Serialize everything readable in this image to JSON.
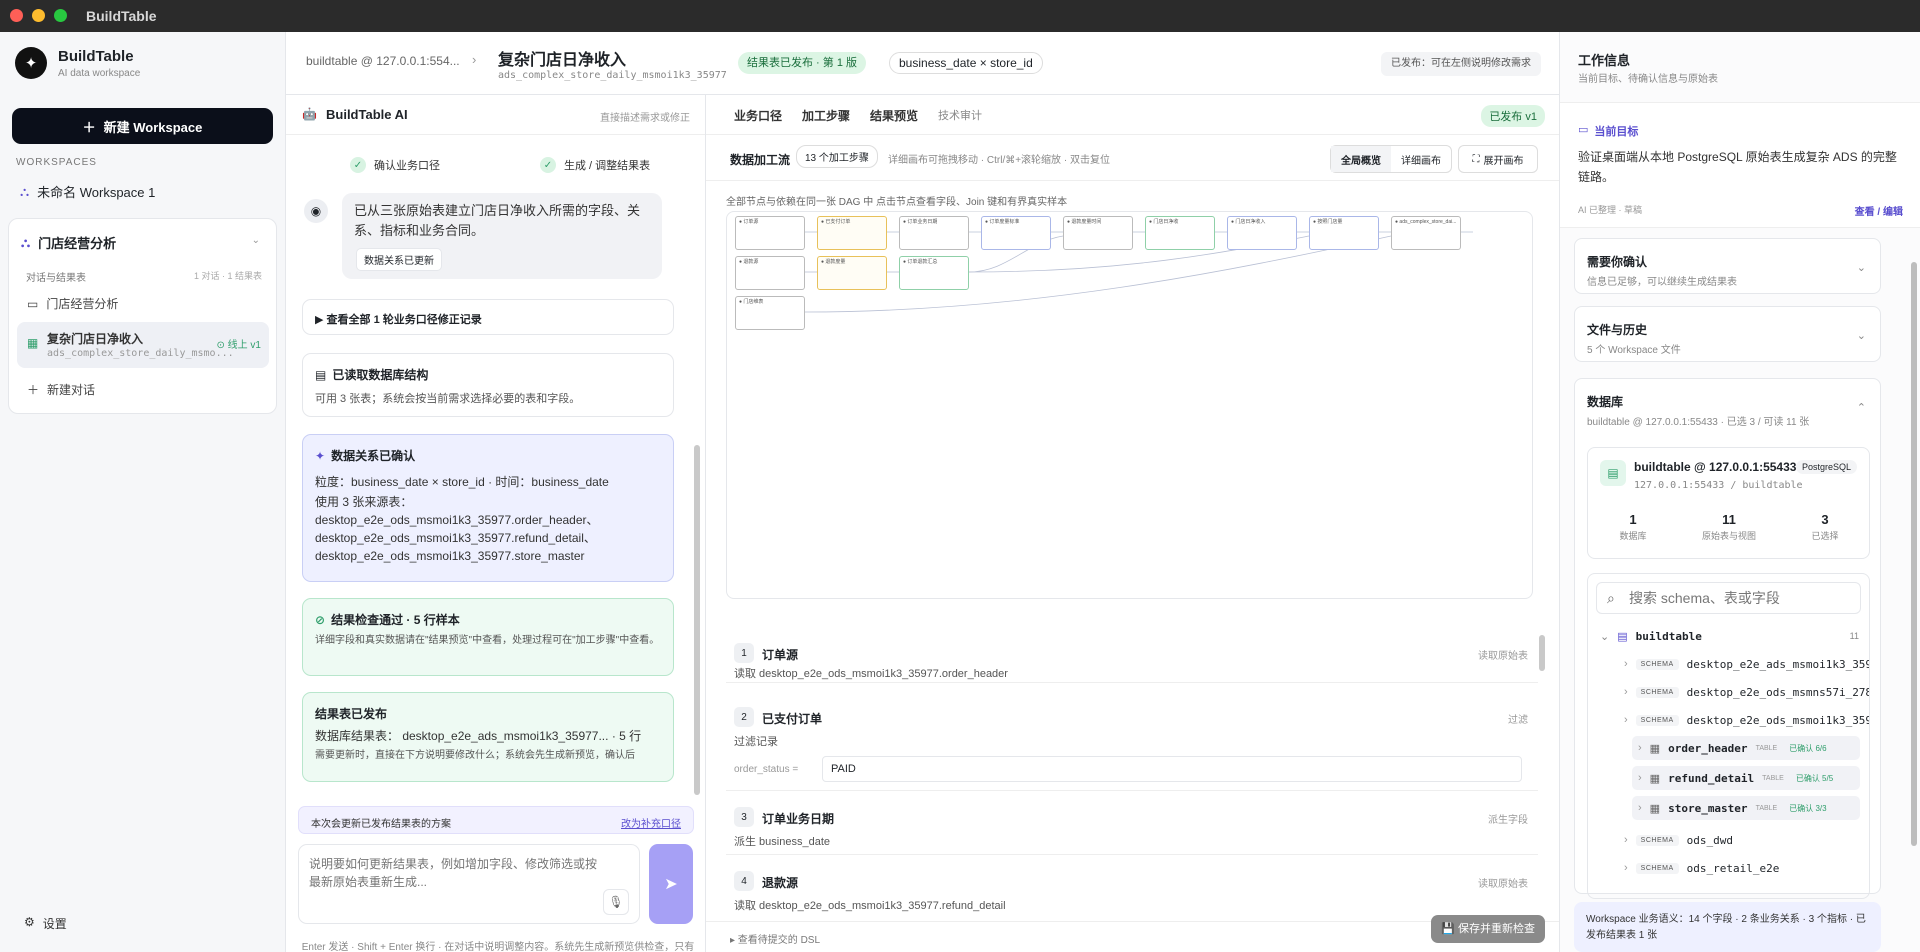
{
  "window": {
    "title": "BuildTable"
  },
  "sidebar": {
    "brand": "BuildTable",
    "brand_sub": "AI data workspace",
    "new_button": "新建 Workspace",
    "ws_header": "WORKSPACES",
    "ws_unnamed": "未命名 Workspace 1",
    "ws_active": "门店经营分析",
    "section": "对话与结果表",
    "section_meta": "1 对话 · 1 结果表",
    "conv": "门店经营分析",
    "result_name": "复杂门店日净收入",
    "result_sub": "ads_complex_store_daily_msmo...",
    "result_badge": "线上 v1",
    "new_conv": "新建对话",
    "settings": "设置"
  },
  "header": {
    "crumb": "buildtable @ 127.0.0.1:554...",
    "title": "复杂门店日净收入",
    "subtitle": "ads_complex_store_daily_msmoi1k3_35977",
    "status": "结果表已发布 · 第 1 版",
    "grain": "business_date × store_id",
    "notice": "已发布：可在左侧说明修改需求"
  },
  "chat": {
    "title": "BuildTable AI",
    "hint": "直接描述需求或修正",
    "step1": "确认业务口径",
    "step2": "生成 / 调整结果表",
    "bubble": "已从三张原始表建立门店日净收入所需的字段、关系、指标和业务合同。",
    "bubble_tag": "数据关系已更新",
    "history": "▶ 查看全部 1 轮业务口径修正记录",
    "c1_title": "已读取数据库结构",
    "c1_body": "可用 3 张表；系统会按当前需求选择必要的表和字段。",
    "c2_title": "数据关系已确认",
    "c2_l1": "粒度：business_date × store_id · 时间：business_date",
    "c2_l2": "使用 3 张来源表：",
    "c2_l3": "desktop_e2e_ods_msmoi1k3_35977.order_header、",
    "c2_l4": "desktop_e2e_ods_msmoi1k3_35977.refund_detail、",
    "c2_l5": "desktop_e2e_ods_msmoi1k3_35977.store_master",
    "c3_title": "结果检查通过 · 5 行样本",
    "c3_body": "详细字段和真实数据请在\"结果预览\"中查看，处理过程可在\"加工步骤\"中查看。",
    "c4_title": "结果表已发布",
    "c4_l1": "数据库结果表： desktop_e2e_ads_msmoi1k3_35977... · 5 行",
    "c4_l2": "需要更新时，直接在下方说明要修改什么；系统会先生成新预览，确认后",
    "notice_a": "本次会更新已发布结果表的方案",
    "notice_b": "改为补充口径",
    "placeholder": "说明要如何更新结果表，例如增加字段、修改筛选或按最新原始表重新生成...",
    "footer": "Enter 发送 · Shift + Enter 换行 · 在对话中说明调整内容。系统先生成新预览供检查，只有再次发布才会更新稳定结果。"
  },
  "main": {
    "tabs": [
      "业务口径",
      "加工步骤",
      "结果预览",
      "技术审计"
    ],
    "published": "已发布 v1",
    "flow_title": "数据加工流",
    "flow_count": "13 个加工步骤",
    "flow_desc": "详细画布可拖拽移动 · Ctrl/⌘+滚轮缩放 · 双击复位",
    "seg_a": "全局概览",
    "seg_b": "详细画布",
    "expand": "展开画布",
    "canvas_hint": "全部节点与依赖在同一张 DAG 中      点击节点查看字段、Join 键和有界真实样本",
    "nodes_row1": [
      "订单源",
      "已支付订单",
      "订单业务日期",
      "订单度量标准",
      "退款度量时间",
      "门店日净收",
      "门店日净收入",
      "按照门店量",
      "ads_complex_store_dai..."
    ],
    "nodes_row2": [
      "退款源",
      "退款度量",
      "订单退款汇总"
    ],
    "nodes_row3": [
      "门店维表"
    ],
    "steps": [
      {
        "no": "1",
        "title": "订单源",
        "tag": "读取原始表",
        "desc": "读取 desktop_e2e_ods_msmoi1k3_35977.order_header"
      },
      {
        "no": "2",
        "title": "已支付订单",
        "tag": "过滤",
        "desc": "过滤记录",
        "field": "order_status =",
        "value": "PAID"
      },
      {
        "no": "3",
        "title": "订单业务日期",
        "tag": "派生字段",
        "desc": "派生 business_date"
      },
      {
        "no": "4",
        "title": "退款源",
        "tag": "读取原始表",
        "desc": "读取 desktop_e2e_ods_msmoi1k3_35977.refund_detail"
      }
    ],
    "dsl": "▸ 查看待提交的 DSL",
    "save": "保存并重新检查"
  },
  "right": {
    "title": "工作信息",
    "sub": "当前目标、待确认信息与原始表",
    "goal_t": "当前目标",
    "goal": "验证桌面端从本地 PostgreSQL 原始表生成复杂 ADS 的完整链路。",
    "goal_s": "AI 已整理 · 草稿",
    "goal_e": "查看 / 编辑",
    "a1_t": "需要你确认",
    "a1_s": "信息已足够，可以继续生成结果表",
    "a2_t": "文件与历史",
    "a2_s": "5 个 Workspace 文件",
    "a3_t": "数据库",
    "a3_s": "buildtable @ 127.0.0.1:55433 · 已选 3 / 可读 11 张",
    "db_name": "buildtable @ 127.0.0.1:55433",
    "db_engine": "PostgreSQL",
    "db_addr": "127.0.0.1:55433 / buildtable",
    "stat1": "1",
    "stat1_l": "数据库",
    "stat2": "11",
    "stat2_l": "原始表与视图",
    "stat3": "3",
    "stat3_l": "已选择",
    "search": "搜索 schema、表或字段",
    "root": "buildtable",
    "root_count": "11",
    "schema_tag": "SCHEMA",
    "table_tag": "TABLE",
    "schemas": [
      "desktop_e2e_ads_msmoi1k3_359...",
      "desktop_e2e_ods_msmns57i_278...",
      "desktop_e2e_ods_msmoi1k3_359...",
      "ods_dwd",
      "ods_retail_e2e"
    ],
    "tables": [
      {
        "n": "order_header",
        "ok": "已确认 6/6"
      },
      {
        "n": "refund_detail",
        "ok": "已确认 5/5"
      },
      {
        "n": "store_master",
        "ok": "已确认 3/3"
      }
    ],
    "summary": "Workspace 业务语义：14 个字段 · 2 条业务关系 · 3 个指标 · 已发布结果表 1 张"
  }
}
